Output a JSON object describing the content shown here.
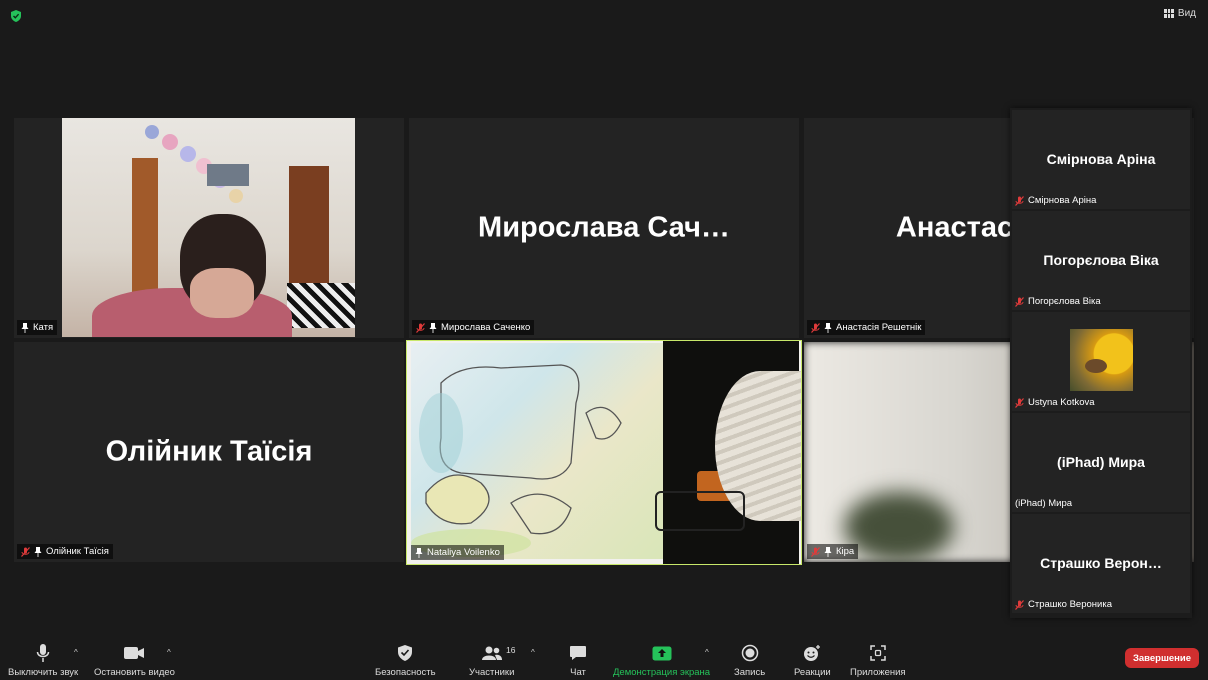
{
  "header": {
    "view_label": "Вид"
  },
  "tiles": [
    {
      "name_tag": "Катя"
    },
    {
      "big_name": "Мирослава  Сач…",
      "name_tag": "Мирослава Саченко"
    },
    {
      "big_name": "Анастасія",
      "name_tag": "Анастасія Решетнік"
    },
    {
      "big_name": "Олійник Таїсія",
      "name_tag": "Олійник Таїсія"
    },
    {
      "name_tag": "Nataliya Voilenko"
    },
    {
      "name_tag": "Кіра"
    }
  ],
  "side_panel": [
    {
      "big_name": "Смірнова Аріна",
      "name_tag": "Смірнова Аріна"
    },
    {
      "big_name": "Погорєлова Віка",
      "name_tag": "Погорєлова Віка"
    },
    {
      "name_tag": "Ustyna Kotkova"
    },
    {
      "big_name": "(iPhad) Мира",
      "name_tag": "(iPhad) Мира"
    },
    {
      "big_name": "Страшко  Верон…",
      "name_tag": "Страшко Вероника"
    }
  ],
  "toolbar": {
    "mute_label": "Выключить звук",
    "video_label": "Остановить видео",
    "security_label": "Безопасность",
    "participants_label": "Участники",
    "participants_count": "16",
    "chat_label": "Чат",
    "share_label": "Демонстрация экрана",
    "record_label": "Запись",
    "reactions_label": "Реакции",
    "apps_label": "Приложения",
    "end_label": "Завершение"
  },
  "colors": {
    "accent_green": "#25c25a",
    "end_red": "#d02f2f",
    "active_speaker": "#c8e86a"
  }
}
